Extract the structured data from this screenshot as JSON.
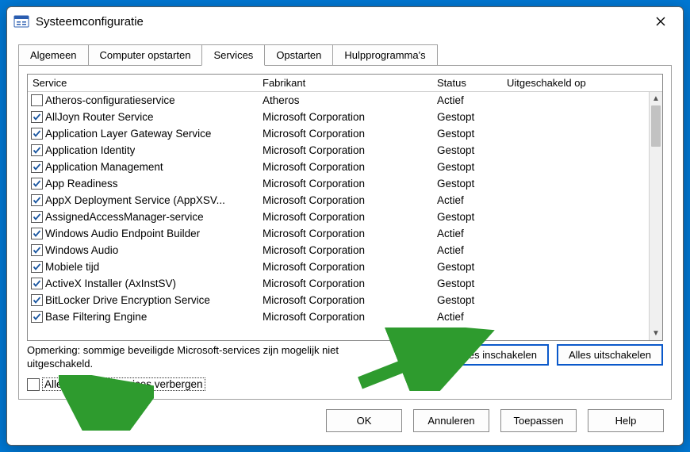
{
  "window": {
    "title": "Systeemconfiguratie"
  },
  "tabs": [
    {
      "label": "Algemeen",
      "active": false
    },
    {
      "label": "Computer opstarten",
      "active": false
    },
    {
      "label": "Services",
      "active": true
    },
    {
      "label": "Opstarten",
      "active": false
    },
    {
      "label": "Hulpprogramma's",
      "active": false
    }
  ],
  "columns": {
    "service": "Service",
    "vendor": "Fabrikant",
    "status": "Status",
    "disabled_on": "Uitgeschakeld op"
  },
  "rows": [
    {
      "checked": false,
      "name": "Atheros-configuratieservice",
      "vendor": "Atheros",
      "status": "Actief"
    },
    {
      "checked": true,
      "name": "AllJoyn Router Service",
      "vendor": "Microsoft Corporation",
      "status": "Gestopt"
    },
    {
      "checked": true,
      "name": "Application Layer Gateway Service",
      "vendor": "Microsoft Corporation",
      "status": "Gestopt"
    },
    {
      "checked": true,
      "name": "Application Identity",
      "vendor": "Microsoft Corporation",
      "status": "Gestopt"
    },
    {
      "checked": true,
      "name": "Application Management",
      "vendor": "Microsoft Corporation",
      "status": "Gestopt"
    },
    {
      "checked": true,
      "name": "App Readiness",
      "vendor": "Microsoft Corporation",
      "status": "Gestopt"
    },
    {
      "checked": true,
      "name": "AppX Deployment Service (AppXSV...",
      "vendor": "Microsoft Corporation",
      "status": "Actief"
    },
    {
      "checked": true,
      "name": "AssignedAccessManager-service",
      "vendor": "Microsoft Corporation",
      "status": "Gestopt"
    },
    {
      "checked": true,
      "name": "Windows Audio Endpoint Builder",
      "vendor": "Microsoft Corporation",
      "status": "Actief"
    },
    {
      "checked": true,
      "name": "Windows Audio",
      "vendor": "Microsoft Corporation",
      "status": "Actief"
    },
    {
      "checked": true,
      "name": "Mobiele tijd",
      "vendor": "Microsoft Corporation",
      "status": "Gestopt"
    },
    {
      "checked": true,
      "name": "ActiveX Installer (AxInstSV)",
      "vendor": "Microsoft Corporation",
      "status": "Gestopt"
    },
    {
      "checked": true,
      "name": "BitLocker Drive Encryption Service",
      "vendor": "Microsoft Corporation",
      "status": "Gestopt"
    },
    {
      "checked": true,
      "name": "Base Filtering Engine",
      "vendor": "Microsoft Corporation",
      "status": "Actief"
    }
  ],
  "note": "Opmerking: sommige beveiligde Microsoft-services zijn mogelijk niet uitgeschakeld.",
  "buttons": {
    "enable_all": "Alles inschakelen",
    "disable_all": "Alles uitschakelen",
    "hide_ms": "Alle Microsoft-services verbergen",
    "ok": "OK",
    "cancel": "Annuleren",
    "apply": "Toepassen",
    "help": "Help"
  },
  "colors": {
    "arrow": "#2e9b2e"
  }
}
